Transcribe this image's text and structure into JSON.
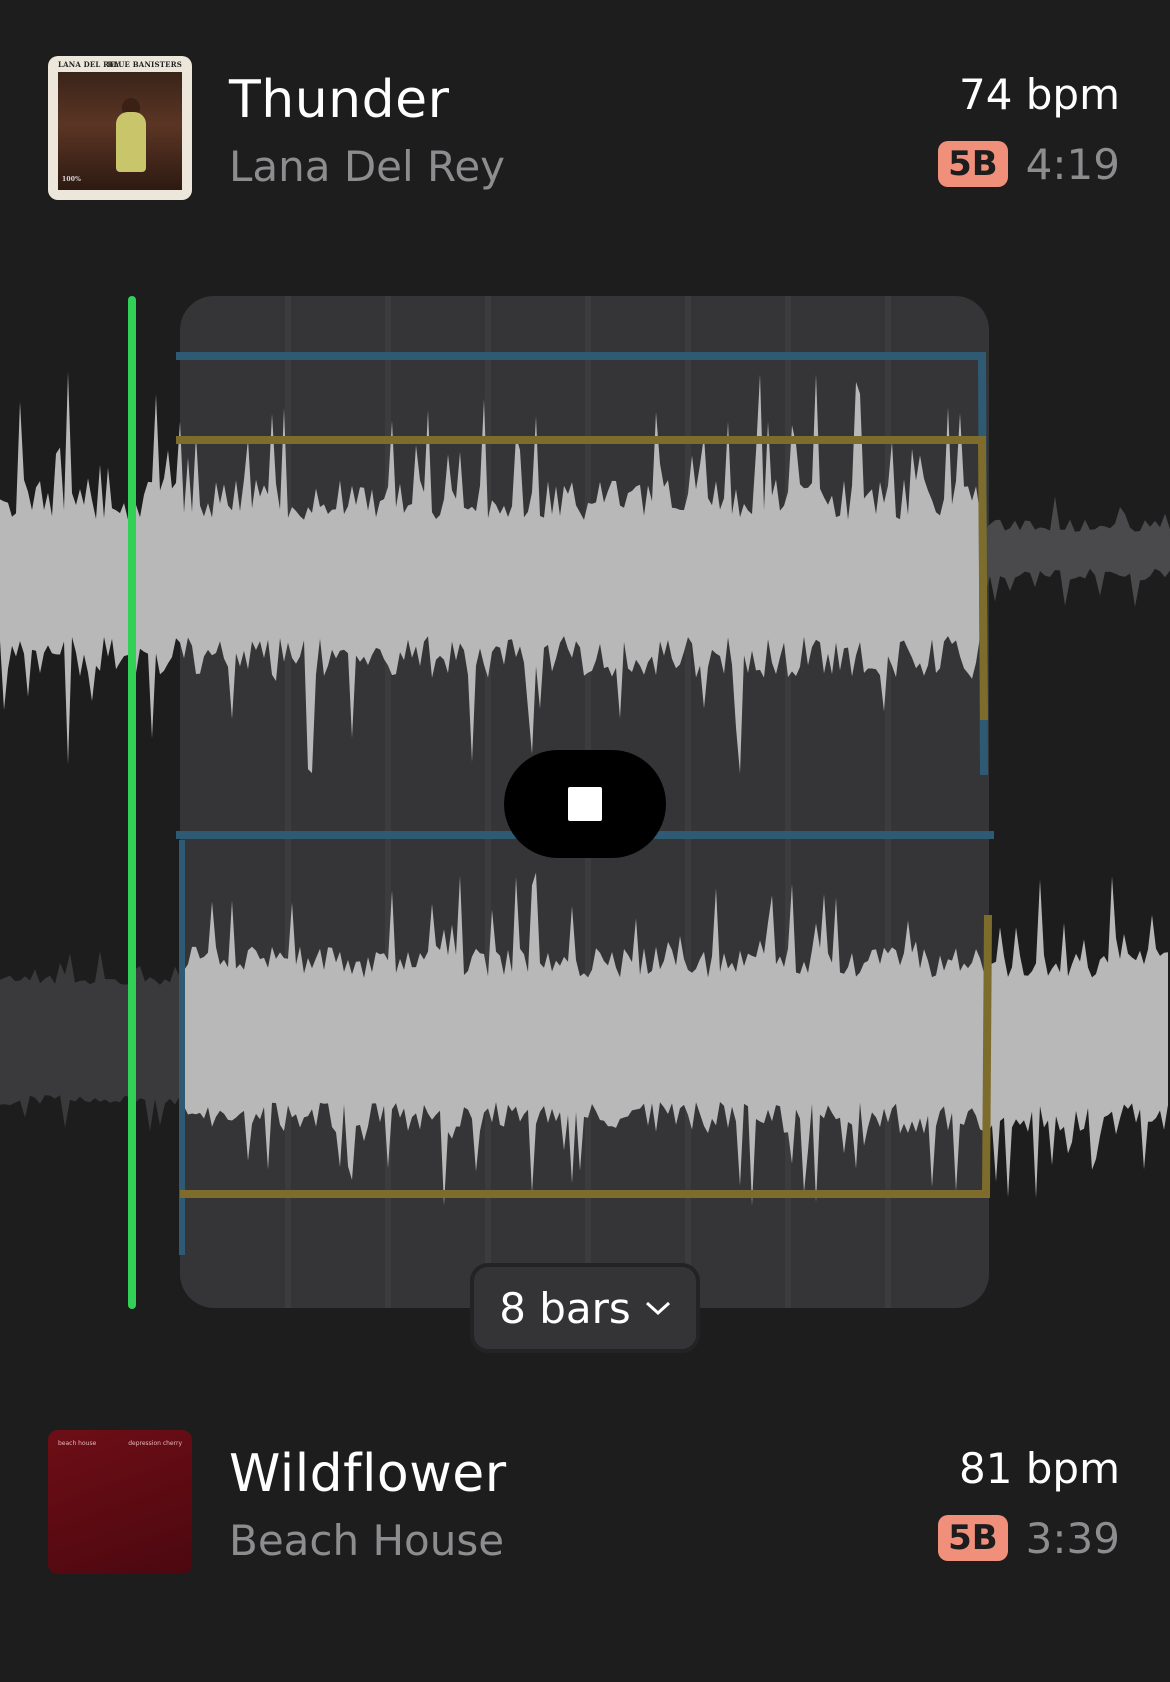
{
  "tracks": [
    {
      "title": "Thunder",
      "artist": "Lana Del Rey",
      "bpm": "74 bpm",
      "key": "5B",
      "duration": "4:19",
      "artwork": {
        "caption_left": "LANA DEL REY",
        "caption_right": "BLUE BANISTERS",
        "caption_corner": "100%"
      }
    },
    {
      "title": "Wildflower",
      "artist": "Beach House",
      "bpm": "81 bpm",
      "key": "5B",
      "duration": "3:39",
      "artwork": {
        "caption_left": "beach house",
        "caption_right": "depression cherry"
      }
    }
  ],
  "transition": {
    "length_label": "8 bars",
    "playback_state": "playing"
  },
  "colors": {
    "background": "#1d1d1e",
    "playhead": "#31d158",
    "key_badge": "#f0907b",
    "window": "#353537",
    "blue_line": "#2f5a73",
    "yellow_line": "#7d6c2b",
    "waveform": "#b8b8b8"
  }
}
